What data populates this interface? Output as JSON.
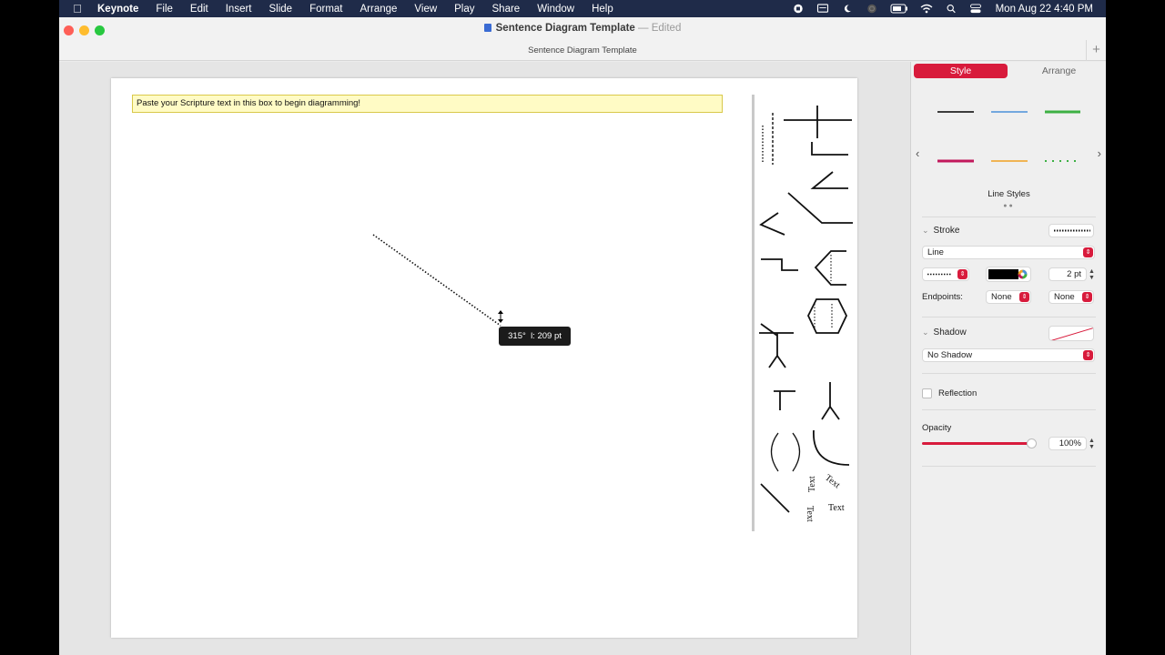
{
  "menubar": {
    "app_name": "Keynote",
    "menus": [
      "File",
      "Edit",
      "Insert",
      "Slide",
      "Format",
      "Arrange",
      "View",
      "Play",
      "Share",
      "Window",
      "Help"
    ],
    "clock": "Mon Aug 22  4:40 PM",
    "status_icons": [
      "stop-recording-icon",
      "display-icon",
      "do-not-disturb-icon",
      "airdrop-icon",
      "battery-icon",
      "wifi-icon",
      "search-icon",
      "control-center-icon"
    ]
  },
  "window": {
    "doc_name": "Sentence Diagram Template",
    "edited_label": "Edited",
    "separator": "—",
    "tab_title": "Sentence Diagram Template",
    "add_tab_label": "+"
  },
  "slide": {
    "scripture_box_text": "Paste your Scripture text in this box to begin diagramming!",
    "palette_text_labels": [
      "Text",
      "Text",
      "Text",
      "Text"
    ]
  },
  "line_tool": {
    "tooltip_angle": "315°",
    "tooltip_length": "l: 209 pt"
  },
  "inspector": {
    "tabs": {
      "style": "Style",
      "arrange": "Arrange"
    },
    "line_styles_label": "Line Styles",
    "line_style_colors": [
      "#000000",
      "#4a90d9",
      "#3cb043",
      "#c2185b",
      "#f0a020",
      "#3cb043"
    ],
    "stroke": {
      "heading": "Stroke",
      "type": "Line",
      "color": "#000000",
      "width": "2 pt",
      "endpoints_label": "Endpoints:",
      "start_endpoint": "None",
      "end_endpoint": "None"
    },
    "shadow": {
      "heading": "Shadow",
      "value": "No Shadow"
    },
    "reflection": {
      "label": "Reflection",
      "checked": false
    },
    "opacity": {
      "label": "Opacity",
      "value": "100%",
      "fraction": 1.0
    },
    "accent_color": "#d81b3c"
  }
}
